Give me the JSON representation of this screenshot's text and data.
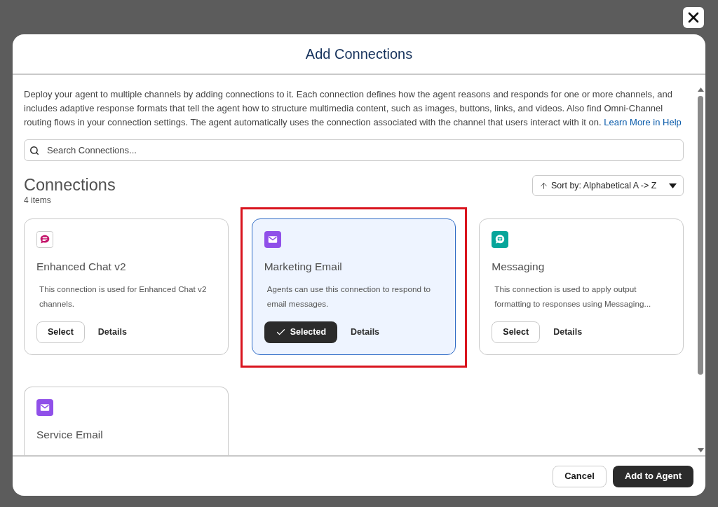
{
  "dialog": {
    "title": "Add Connections"
  },
  "description": {
    "text": "Deploy your agent to multiple channels by adding connections to it. Each connection defines how the agent reasons and responds for one or more channels, and includes adaptive response formats that tell the agent how to structure multimedia content, such as images, buttons, links, and videos. Also find Omni-Channel routing flows in your connection settings. The agent automatically uses the connection associated with the channel that users interact with it on.",
    "link": "Learn More in Help"
  },
  "search": {
    "placeholder": "Search Connections..."
  },
  "section": {
    "title": "Connections",
    "count": "4 items"
  },
  "sort": {
    "label": "Sort by: Alphabetical A -> Z"
  },
  "connections": [
    {
      "kind": "chat",
      "name": "Enhanced Chat v2",
      "description": "This connection is used for Enhanced Chat v2 channels.",
      "action": "Select",
      "details": "Details",
      "selected": false,
      "highlighted": false
    },
    {
      "kind": "email",
      "name": "Marketing Email",
      "description": "Agents can use this connection to respond to email messages.",
      "action": "Selected",
      "details": "Details",
      "selected": true,
      "highlighted": true
    },
    {
      "kind": "messaging",
      "name": "Messaging",
      "description": "This connection is used to apply output formatting to responses using Messaging...",
      "action": "Select",
      "details": "Details",
      "selected": false,
      "highlighted": false
    },
    {
      "kind": "email",
      "name": "Service Email",
      "selected": false,
      "highlighted": false
    }
  ],
  "footer": {
    "buttons": [
      {
        "label": "Cancel",
        "kind": "secondary"
      },
      {
        "label": "Add to Agent",
        "kind": "primary"
      }
    ]
  }
}
